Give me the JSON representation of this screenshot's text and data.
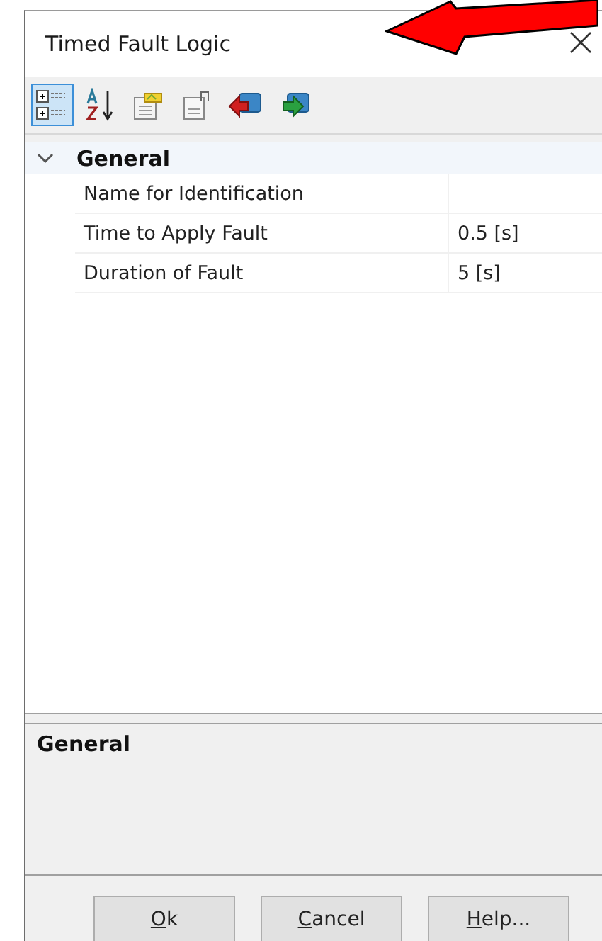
{
  "window": {
    "title": "Timed Fault Logic"
  },
  "toolbar": [
    {
      "kind": "categorized",
      "selected": true
    },
    {
      "kind": "alphabetical",
      "selected": false
    },
    {
      "kind": "pages",
      "selected": false
    },
    {
      "kind": "export",
      "selected": false
    },
    {
      "kind": "back",
      "selected": false
    },
    {
      "kind": "forward",
      "selected": false
    }
  ],
  "property_grid": {
    "group": {
      "label": "General",
      "expanded": true
    },
    "rows": [
      {
        "name": "Name for Identification",
        "value": ""
      },
      {
        "name": "Time to Apply Fault",
        "value": "0.5 [s]"
      },
      {
        "name": "Duration of Fault",
        "value": "5 [s]"
      }
    ]
  },
  "description": {
    "title": "General"
  },
  "buttons": [
    {
      "label": "Ok",
      "underline_first": true
    },
    {
      "label": "Cancel",
      "underline_first": true
    },
    {
      "label": "Help...",
      "underline_first": true
    }
  ],
  "annotation": {
    "kind": "arrow"
  }
}
